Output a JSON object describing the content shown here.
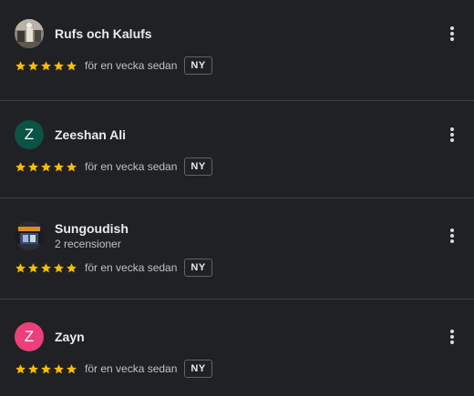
{
  "colors": {
    "background": "#202124",
    "star": "#fbbc04",
    "divider": "#3c4043"
  },
  "reviews": [
    {
      "name": "Rufs och Kalufs",
      "avatar": {
        "type": "photo",
        "icon": "salon-photo-avatar"
      },
      "rating": 5,
      "when": "för en vecka sedan",
      "badge": "NY"
    },
    {
      "name": "Zeeshan Ali",
      "avatar": {
        "type": "letter",
        "letter": "Z",
        "color": "#0b5345"
      },
      "rating": 5,
      "when": "för en vecka sedan",
      "badge": "NY"
    },
    {
      "name": "Sungoudish",
      "subtitle": "2 recensioner",
      "avatar": {
        "type": "photo",
        "icon": "storefront-photo-avatar"
      },
      "rating": 5,
      "when": "för en vecka sedan",
      "badge": "NY"
    },
    {
      "name": "Zayn",
      "avatar": {
        "type": "letter",
        "letter": "Z",
        "color": "#ec407a"
      },
      "rating": 5,
      "when": "för en vecka sedan",
      "badge": "NY"
    }
  ]
}
